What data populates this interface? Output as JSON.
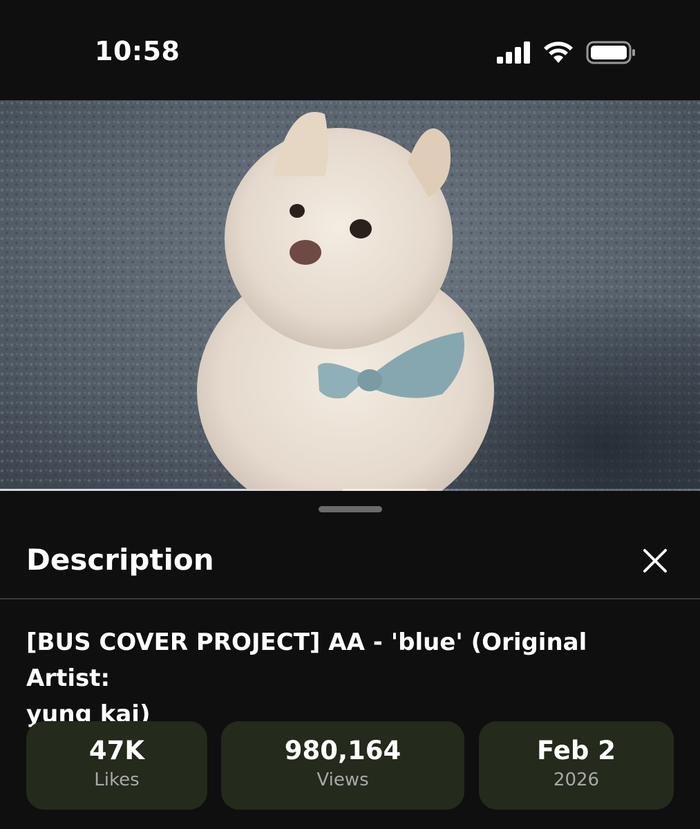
{
  "status_bar": {
    "time": "10:58",
    "icons": [
      "cellular-signal-icon",
      "wifi-icon",
      "battery-icon"
    ]
  },
  "video": {
    "progress_played": 0.49,
    "progress_buffered": 0.61
  },
  "description_sheet": {
    "title": "Description",
    "close_icon": "close-icon",
    "video_title_line1": "[BUS COVER PROJECT] AA - 'blue' (Original Artist:",
    "video_title_line2": "yung kai)",
    "stats": {
      "likes": {
        "value": "47K",
        "label": "Likes"
      },
      "views": {
        "value": "980,164",
        "label": "Views"
      },
      "date": {
        "value": "Feb 2",
        "label": "2026"
      }
    }
  },
  "colors": {
    "background": "#0f0f0f",
    "stat_card": "#242a1c",
    "secondary_text": "#a8a8a8"
  }
}
